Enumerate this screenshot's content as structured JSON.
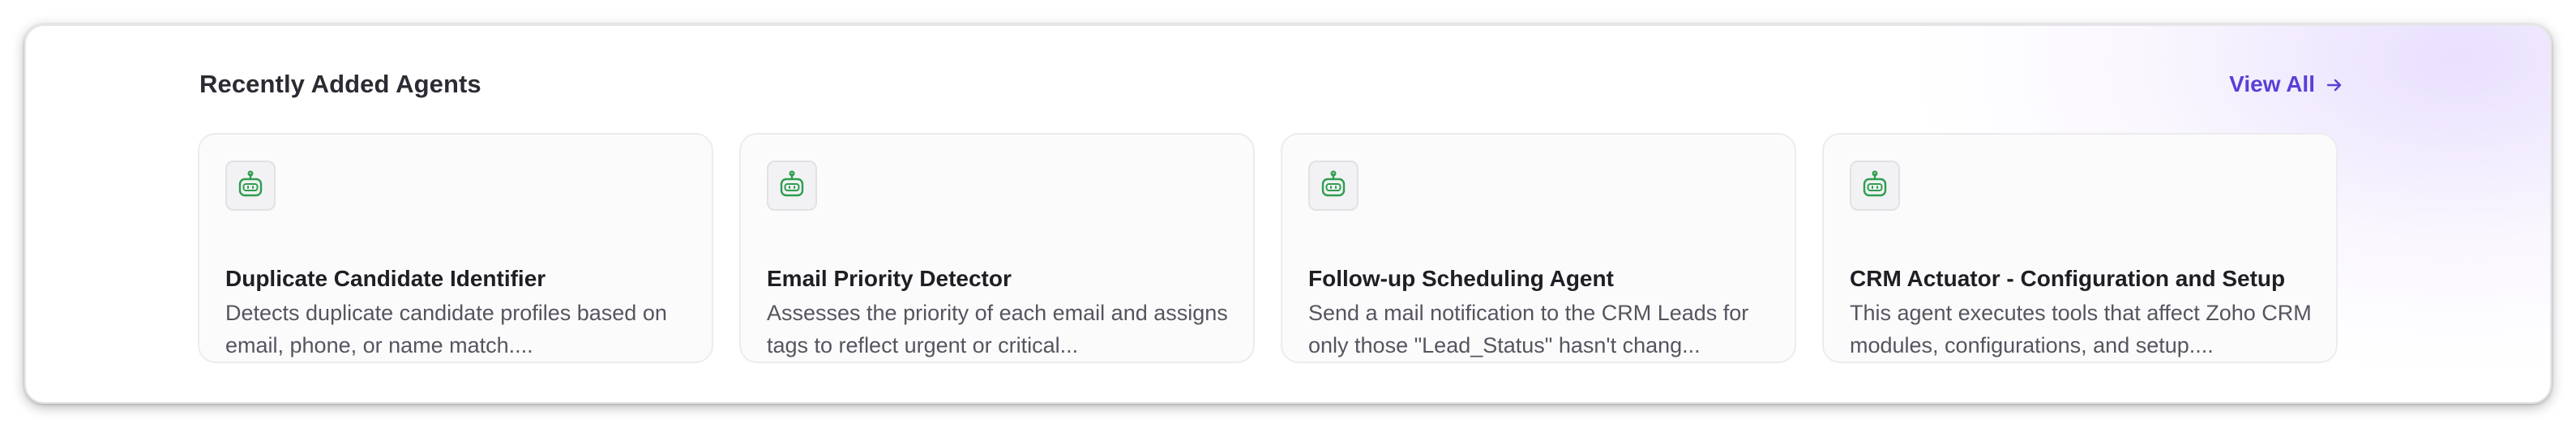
{
  "section": {
    "title": "Recently Added Agents",
    "view_all_label": "View All"
  },
  "colors": {
    "accent": "#5b3fd6",
    "icon_green": "#2e9e4f",
    "card_bg": "#fbfbfc"
  },
  "agents": [
    {
      "icon": "robot-icon",
      "title": "Duplicate Candidate Identifier",
      "description": "Detects duplicate candidate profiles based on email, phone, or name match...."
    },
    {
      "icon": "robot-icon",
      "title": "Email Priority Detector",
      "description": "Assesses the priority of each email and assigns tags to reflect urgent or critical..."
    },
    {
      "icon": "robot-icon",
      "title": "Follow-up Scheduling Agent",
      "description": "Send a mail notification to the CRM Leads for only those \"Lead_Status\" hasn't chang..."
    },
    {
      "icon": "robot-icon",
      "title": "CRM Actuator - Configuration and Setup",
      "description": "This agent executes tools that affect Zoho CRM modules, configurations, and setup...."
    }
  ]
}
